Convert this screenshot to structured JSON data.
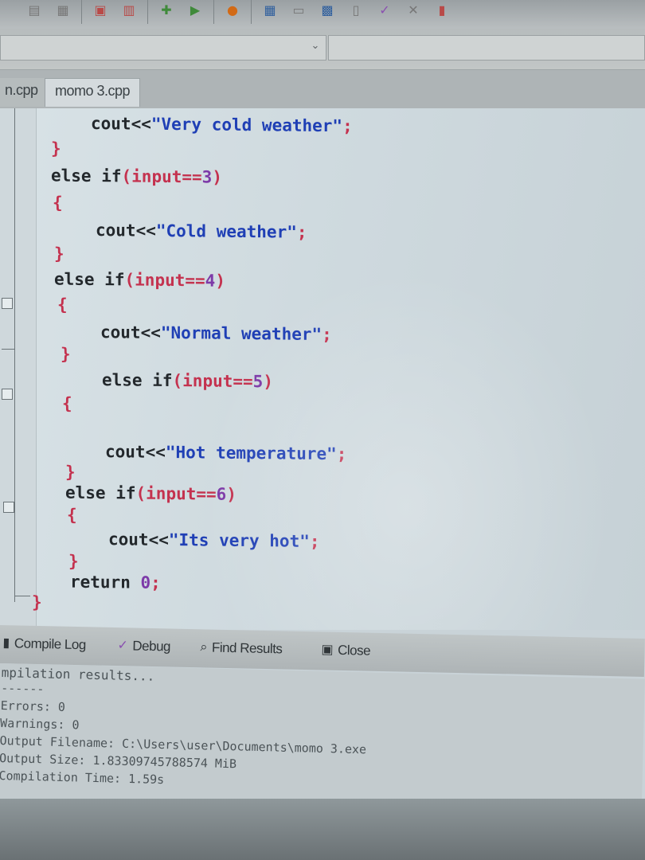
{
  "toolbar": {
    "icons": [
      "save-icon",
      "save-all-icon",
      "print-icon",
      "print-preview-icon",
      "compile-icon",
      "run-icon",
      "stop-icon",
      "grid-icon",
      "window-icon",
      "project-icon",
      "layout-icon",
      "check-icon",
      "cross-icon",
      "chart-icon"
    ]
  },
  "tabs": [
    {
      "label": "n.cpp"
    },
    {
      "label": "momo 3.cpp"
    }
  ],
  "code": {
    "l1": {
      "a": "cout<<",
      "b": "\"Very cold weather\"",
      "c": ";"
    },
    "l2": "}",
    "l3": {
      "a": "else if",
      "b": "(input==",
      "c": "3",
      "d": ")"
    },
    "l4": "{",
    "l5": {
      "a": "cout<<",
      "b": "\"Cold weather\"",
      "c": ";"
    },
    "l6": "}",
    "l7": {
      "a": "else if",
      "b": "(input==",
      "c": "4",
      "d": ")"
    },
    "l8": "{",
    "l9": {
      "a": "cout<<",
      "b": "\"Normal weather\"",
      "c": ";"
    },
    "l10": "}",
    "l11": {
      "a": "else if",
      "b": "(input==",
      "c": "5",
      "d": ")"
    },
    "l12": "{",
    "l13": {
      "a": "cout<<",
      "b": "\"Hot temperature\"",
      "c": ";"
    },
    "l14": "}",
    "l15": {
      "a": "else if",
      "b": "(input==",
      "c": "6",
      "d": ")"
    },
    "l16": "{",
    "l17": {
      "a": "cout<<",
      "b": "\"Its very hot\"",
      "c": ";"
    },
    "l18": "}",
    "l19": {
      "a": "return ",
      "b": "0",
      "c": ";"
    },
    "l20": "}"
  },
  "panel": {
    "compile_log": "Compile Log",
    "debug": "Debug",
    "find_results": "Find Results",
    "close": "Close"
  },
  "output": {
    "l1": "mpilation results...",
    "l2": "------",
    "l3": "Errors: 0",
    "l4": "Warnings: 0",
    "l5": "Output Filename: C:\\Users\\user\\Documents\\momo 3.exe",
    "l6": "Output Size: 1.83309745788574 MiB",
    "l7": "Compilation Time: 1.59s"
  }
}
